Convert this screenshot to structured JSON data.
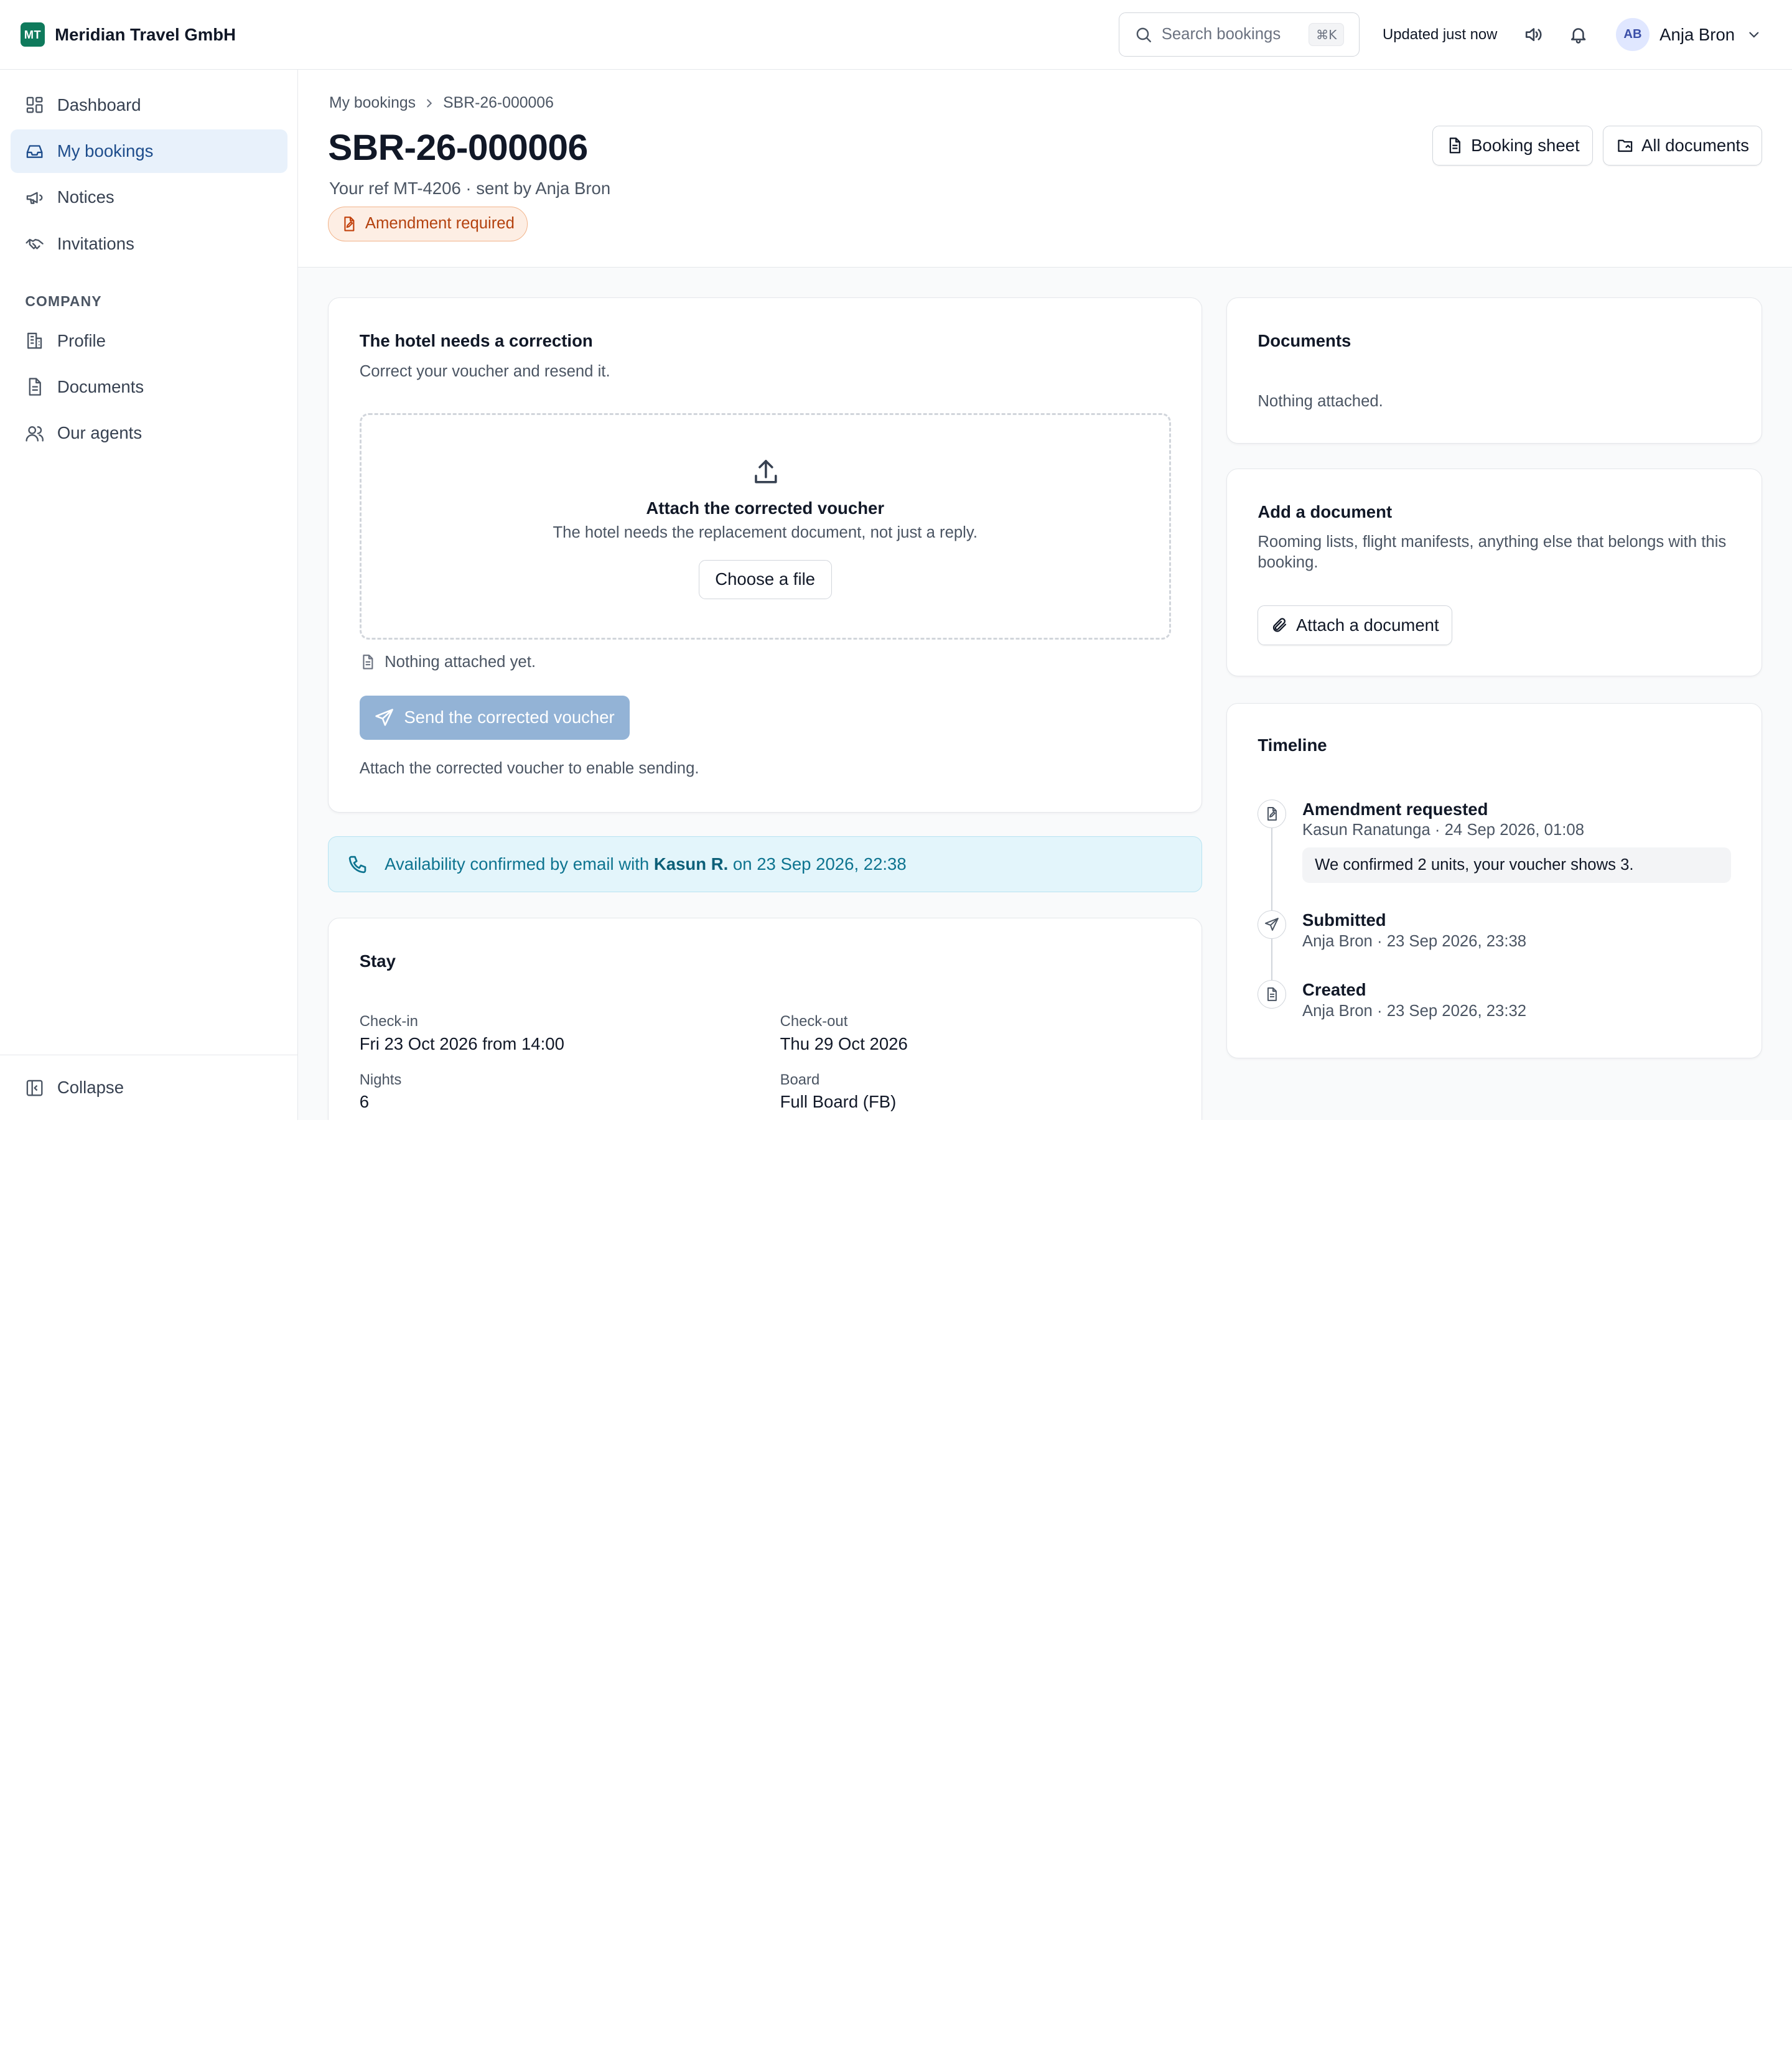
{
  "brand": {
    "initials": "MT",
    "name": "Meridian Travel GmbH",
    "color": "#0f7a5c"
  },
  "topbar": {
    "search_placeholder": "Search bookings",
    "shortcut": "⌘K",
    "updated": "Updated just now",
    "user": {
      "initials": "AB",
      "name": "Anja Bron"
    }
  },
  "sidebar": {
    "items": [
      {
        "label": "Dashboard",
        "icon": "dashboard-icon"
      },
      {
        "label": "My bookings",
        "icon": "inbox-icon",
        "active": true
      },
      {
        "label": "Notices",
        "icon": "megaphone-icon"
      },
      {
        "label": "Invitations",
        "icon": "handshake-icon"
      }
    ],
    "company_label": "COMPANY",
    "company_items": [
      {
        "label": "Profile",
        "icon": "building-icon"
      },
      {
        "label": "Documents",
        "icon": "file-icon"
      },
      {
        "label": "Our agents",
        "icon": "users-icon"
      }
    ],
    "collapse_label": "Collapse"
  },
  "header": {
    "breadcrumb": [
      "My bookings",
      "SBR-26-000006"
    ],
    "title": "SBR-26-000006",
    "subtitle": "Your ref MT-4206 · sent by Anja Bron",
    "status": "Amendment required",
    "actions": [
      "Booking sheet",
      "All documents"
    ]
  },
  "correction": {
    "title": "The hotel needs a correction",
    "subtitle": "Correct your voucher and resend it.",
    "dropzone_title": "Attach the corrected voucher",
    "dropzone_sub": "The hotel needs the replacement document, not just a reply.",
    "choose_file": "Choose a file",
    "attach_status": "Nothing attached yet.",
    "send_button": "Send the corrected voucher",
    "send_hint": "Attach the corrected voucher to enable sending."
  },
  "banner": {
    "prefix": "Availability confirmed by email with ",
    "contact": "Kasun R.",
    "suffix": " on 23 Sep 2026, 22:38"
  },
  "stay": {
    "title": "Stay",
    "checkin_label": "Check-in",
    "checkin_value": "Fri 23 Oct 2026 from 14:00",
    "checkout_label": "Check-out",
    "checkout_value": "Thu 29 Oct 2026",
    "nights_label": "Nights",
    "nights_value": "6",
    "board_label": "Board",
    "board_value": "Full Board (FB)"
  },
  "documents": {
    "title": "Documents",
    "empty": "Nothing attached."
  },
  "add_document": {
    "title": "Add a document",
    "description": "Rooming lists, flight manifests, anything else that belongs with this booking.",
    "button": "Attach a document"
  },
  "timeline": {
    "title": "Timeline",
    "events": [
      {
        "title": "Amendment requested",
        "meta": "Kasun Ranatunga · 24 Sep 2026, 01:08",
        "note": "We confirmed 2 units, your voucher shows 3."
      },
      {
        "title": "Submitted",
        "meta": "Anja Bron · 23 Sep 2026, 23:38"
      },
      {
        "title": "Created",
        "meta": "Anja Bron · 23 Sep 2026, 23:32"
      }
    ]
  }
}
